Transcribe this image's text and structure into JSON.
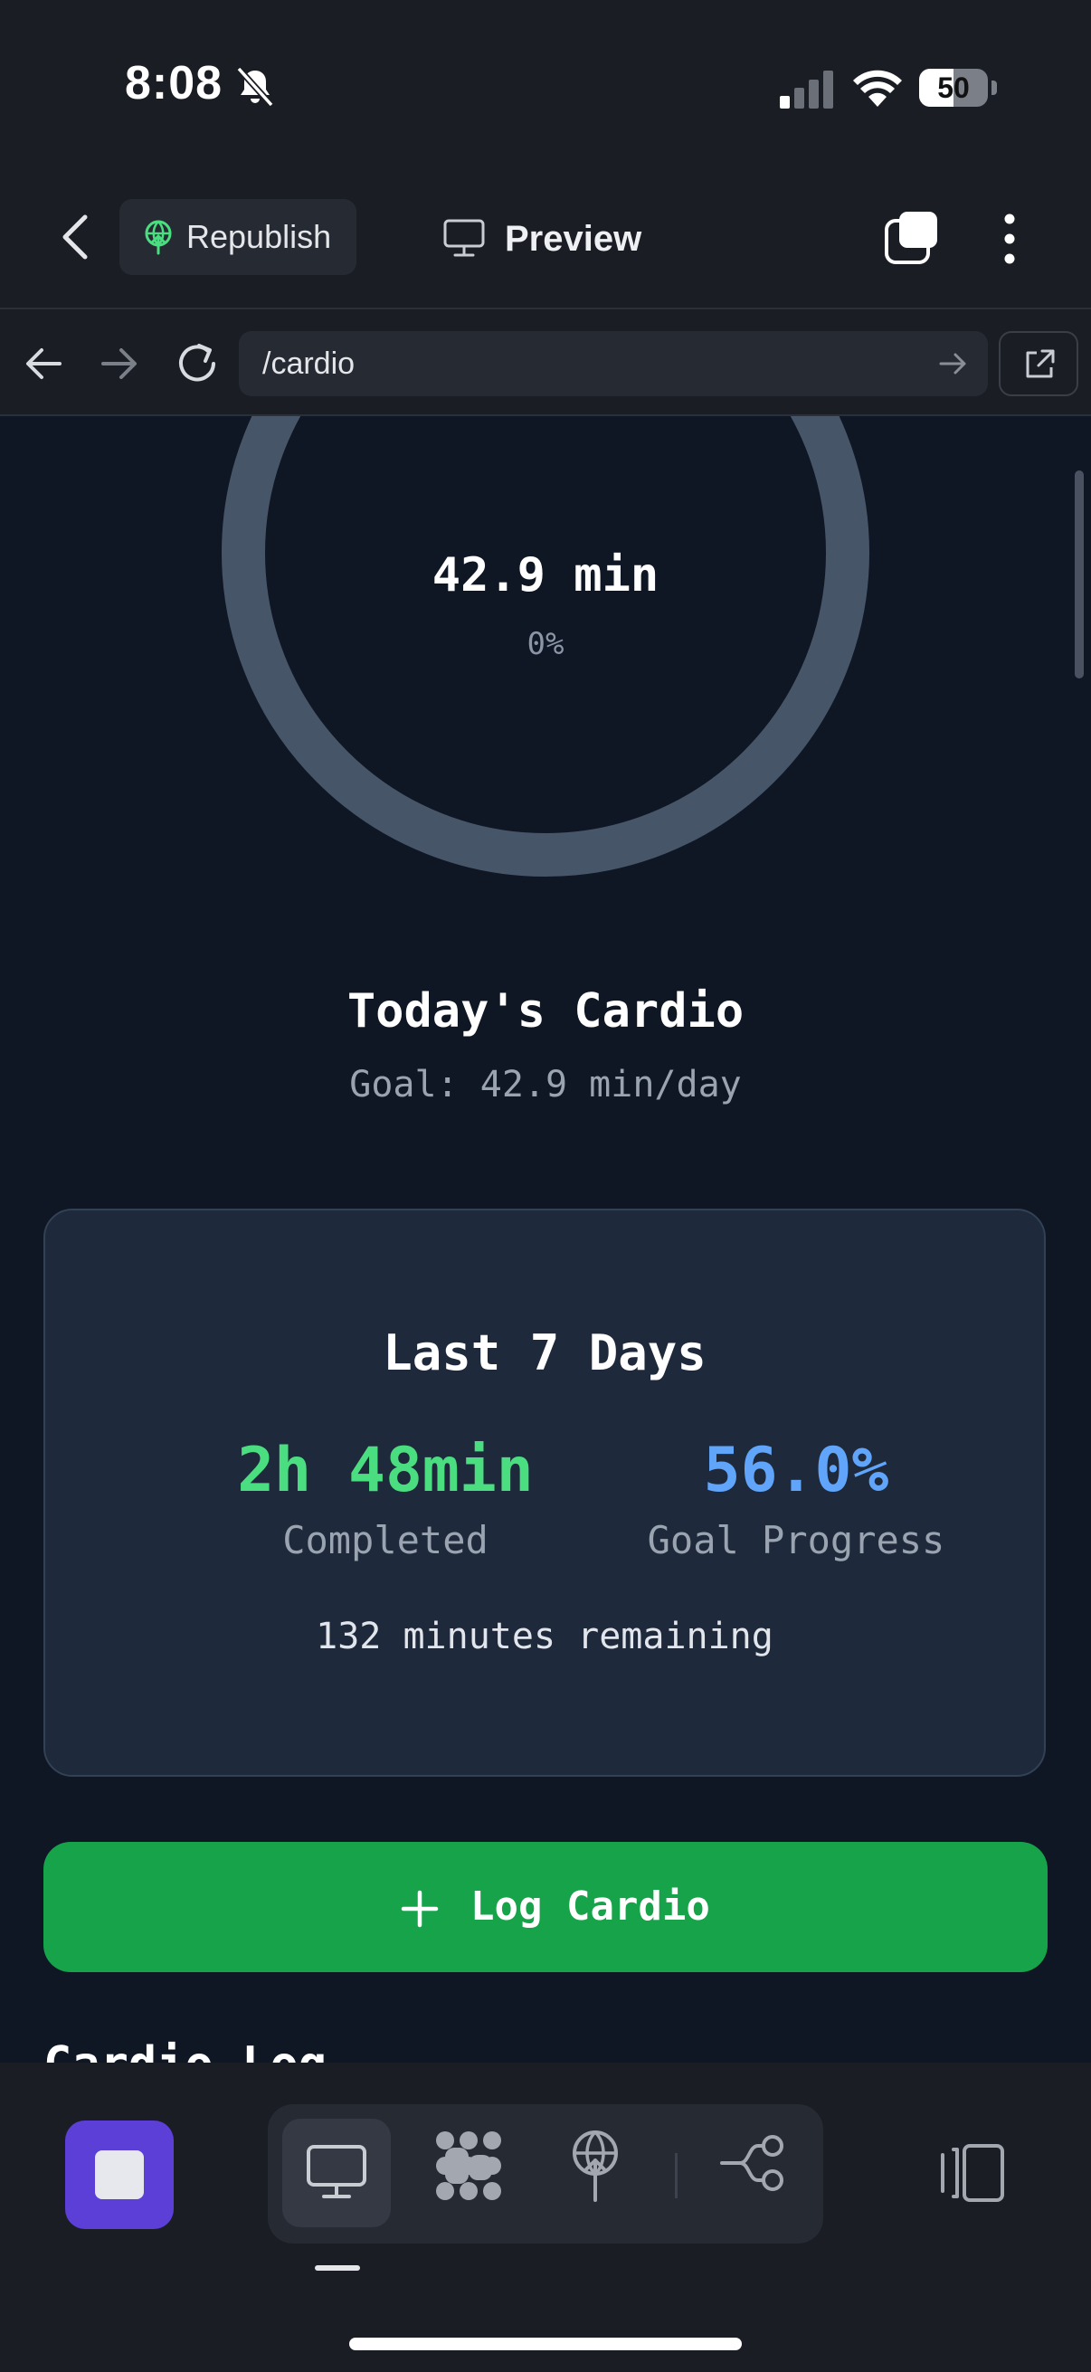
{
  "status_bar": {
    "time": "8:08",
    "battery_level": "50",
    "battery_fraction": 0.5
  },
  "header": {
    "republish_label": "Republish",
    "preview_label": "Preview"
  },
  "url_bar": {
    "path": "/cardio"
  },
  "ring": {
    "value": "42.9 min",
    "percent": "0%",
    "progress_fraction": 0
  },
  "today": {
    "title": "Today's Cardio",
    "goal": "Goal: 42.9 min/day"
  },
  "week": {
    "title": "Last 7 Days",
    "completed_value": "2h 48min",
    "completed_label": "Completed",
    "progress_value": "56.0%",
    "progress_label": "Goal Progress",
    "remaining": "132 minutes remaining"
  },
  "log_button": {
    "label": "Log Cardio"
  },
  "next_section": {
    "heading": "Cardio Log"
  },
  "colors": {
    "accent_green": "#16a34a",
    "completed_green": "#4ade80",
    "progress_blue": "#60a5fa",
    "stop_purple": "#5b3fd6",
    "ring_track": "#475569"
  },
  "icons": {
    "bell": "bell-slash-icon",
    "signal": "cellular-signal-icon",
    "wifi": "wifi-icon",
    "back": "chevron-left-icon",
    "republish": "globe-upload-icon",
    "preview": "monitor-icon",
    "tabs": "tabs-icon",
    "more": "more-vertical-icon",
    "external": "external-link-icon",
    "fab": "checkbox-icon",
    "blocks": "blocks-icon",
    "deploy": "deploy-icon",
    "share": "share-icon",
    "sidebar": "sidebar-toggle-icon"
  }
}
